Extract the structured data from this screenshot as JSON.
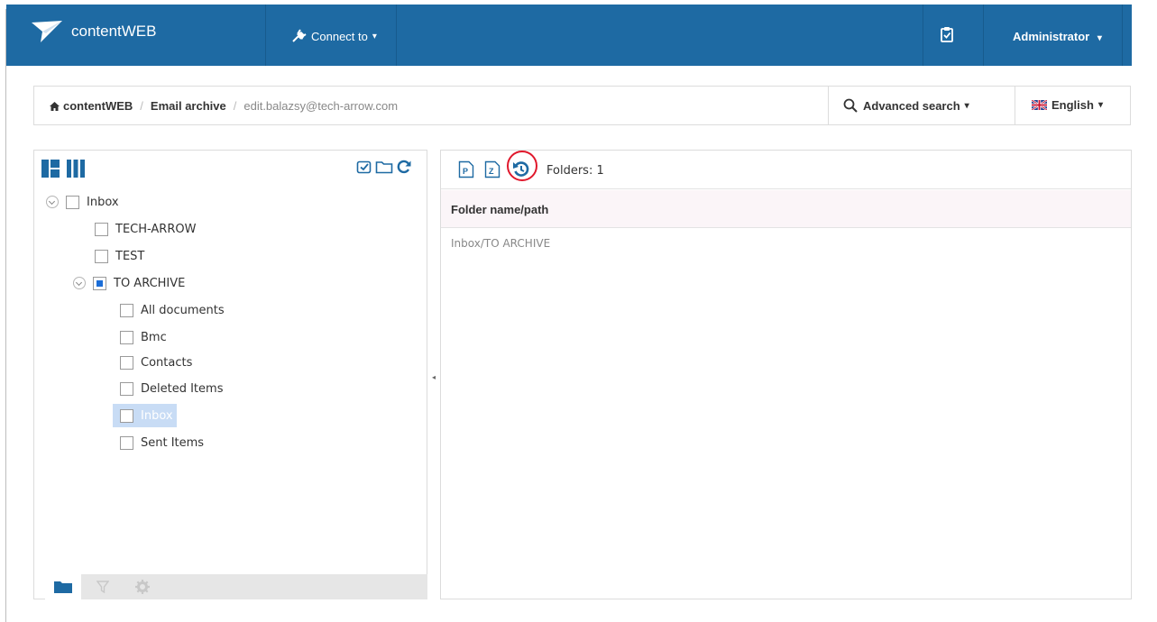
{
  "app": {
    "brand": "contentWEB",
    "connect_label": "Connect to",
    "user_label": "Administrator",
    "accent_color": "#1e6aa3"
  },
  "breadcrumb": {
    "home": "contentWEB",
    "section": "Email archive",
    "mailbox": "edit.balazsy@tech-arrow.com"
  },
  "header_actions": {
    "advanced_search": "Advanced search",
    "language": "English"
  },
  "tree": {
    "items": [
      {
        "label": "Inbox",
        "state": "unchecked",
        "expandable": true
      },
      {
        "label": "TECH-ARROW",
        "state": "unchecked"
      },
      {
        "label": "TEST",
        "state": "unchecked"
      },
      {
        "label": "TO ARCHIVE",
        "state": "partial",
        "expandable": true
      },
      {
        "label": "All documents",
        "state": "unchecked"
      },
      {
        "label": "Bmc",
        "state": "unchecked"
      },
      {
        "label": "Contacts",
        "state": "unchecked"
      },
      {
        "label": "Deleted Items",
        "state": "unchecked"
      },
      {
        "label": "Inbox",
        "state": "unchecked",
        "selected": true
      },
      {
        "label": "Sent Items",
        "state": "unchecked"
      }
    ]
  },
  "results": {
    "folder_count": "Folders: 1",
    "column_header": "Folder name/path",
    "rows": [
      "Inbox/TO ARCHIVE"
    ]
  }
}
